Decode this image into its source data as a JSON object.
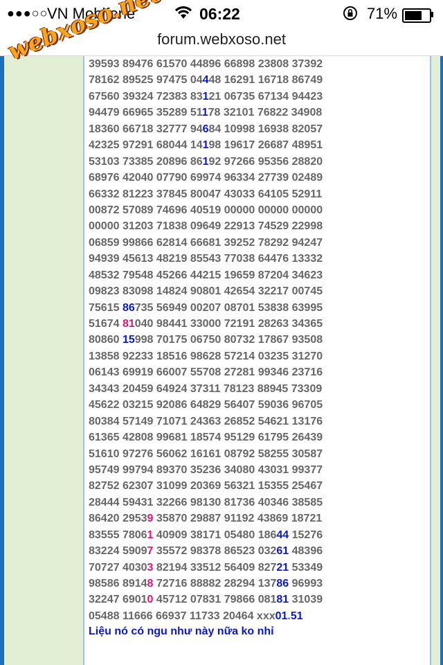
{
  "status_bar": {
    "signal": "●●●○○",
    "carrier": "VN Mobifone",
    "time": "06:22",
    "battery_percent": "71%",
    "battery_level": 0.71
  },
  "browser": {
    "url": "forum.webxoso.net"
  },
  "watermark": "webxoso.net",
  "colors": {
    "highlight_blue": "#0a18c8",
    "highlight_pink": "#e0157f",
    "numbers": "#666666",
    "sidebar": "#e2efd5",
    "border": "#1a6fbf"
  },
  "lines": [
    [
      {
        "t": "39593 89476 61570 44896 66898 23808 37392"
      }
    ],
    [
      {
        "t": "78162 89525 97475 04"
      },
      {
        "t": "4",
        "c": "blue"
      },
      {
        "t": "48 16291 16718 86749"
      }
    ],
    [
      {
        "t": "67560 39324 72383 83"
      },
      {
        "t": "1",
        "c": "blue"
      },
      {
        "t": "21 06735 67134 94423"
      }
    ],
    [
      {
        "t": "94479 66965 35289 51"
      },
      {
        "t": "1",
        "c": "blue"
      },
      {
        "t": "78 32101 76822 34908"
      }
    ],
    [
      {
        "t": "18360 66718 32777 94"
      },
      {
        "t": "6",
        "c": "blue"
      },
      {
        "t": "84 10998 16938 82057"
      }
    ],
    [
      {
        "t": "42325 97291 68044 14"
      },
      {
        "t": "1",
        "c": "blue"
      },
      {
        "t": "98 19617 26687 48951"
      }
    ],
    [
      {
        "t": "53103 73385 20896 86"
      },
      {
        "t": "1",
        "c": "blue"
      },
      {
        "t": "92 97266 95356 28820"
      }
    ],
    [
      {
        "t": "68976 42040 07790 69974 96334 27739 02489"
      }
    ],
    [
      {
        "t": "66332 81223 37845 80047 43033 64105 52911"
      }
    ],
    [
      {
        "t": "00872 57089 74696 40519 00000 00000 00000"
      }
    ],
    [
      {
        "t": "00000 31203 71838 09649 22913 74529 22998"
      }
    ],
    [
      {
        "t": "06859 99866 62814 66681 39252 78292 94247"
      }
    ],
    [
      {
        "t": "94939 45613 48219 85543 77038 64476 13332"
      }
    ],
    [
      {
        "t": "48532 79548 45266 44215 19659 87204 34623"
      }
    ],
    [
      {
        "t": "09823 83098 14824 90801 42654 32217 00745"
      }
    ],
    [
      {
        "t": "75615 "
      },
      {
        "t": "86",
        "c": "blue"
      },
      {
        "t": "735 56949 00207 08701 53838 63995"
      }
    ],
    [
      {
        "t": "51674 "
      },
      {
        "t": "81",
        "c": "pink"
      },
      {
        "t": "040 98441 33000 72191 28263 34365"
      }
    ],
    [
      {
        "t": "80860 "
      },
      {
        "t": "15",
        "c": "blue"
      },
      {
        "t": "998 70175 06750 80732 17867 93508"
      }
    ],
    [
      {
        "t": "13858 92233 18516 98628 57214 03235 31270"
      }
    ],
    [
      {
        "t": "06143 69919 66007 55708 27281 99346 23716"
      }
    ],
    [
      {
        "t": "34343 20459 64924 37311 78123 88945 73309"
      }
    ],
    [
      {
        "t": "45622 03215 92086 64829 56407 59036 96705"
      }
    ],
    [
      {
        "t": "80384 57149 71071 24363 26852 54621 13176"
      }
    ],
    [
      {
        "t": "61365 42808 99681 18574 95129 61795 26439"
      }
    ],
    [
      {
        "t": "51610 97276 56062 16161 08792 58255 30587"
      }
    ],
    [
      {
        "t": "95749 99794 89370 35236 34080 43031 99377"
      }
    ],
    [
      {
        "t": "82752 62307 31099 20369 56321 15355 25467"
      }
    ],
    [
      {
        "t": "28444 59431 32266 98130 81736 40346 38585"
      }
    ],
    [
      {
        "t": "86420 2953"
      },
      {
        "t": "9",
        "c": "pink"
      },
      {
        "t": " 35870 29887 91192 43869 18721"
      }
    ],
    [
      {
        "t": "83555 7806"
      },
      {
        "t": "1",
        "c": "pink"
      },
      {
        "t": " 40909 38171 05480 186"
      },
      {
        "t": "44",
        "c": "blue"
      },
      {
        "t": " 15276"
      }
    ],
    [
      {
        "t": "83224 5909"
      },
      {
        "t": "7",
        "c": "pink"
      },
      {
        "t": " 35572 98378 86523 032"
      },
      {
        "t": "61",
        "c": "blue"
      },
      {
        "t": " 48396"
      }
    ],
    [
      {
        "t": "70727 4030"
      },
      {
        "t": "3",
        "c": "pink"
      },
      {
        "t": " 82194 33512 56409 827"
      },
      {
        "t": "21",
        "c": "blue"
      },
      {
        "t": " 53349"
      }
    ],
    [
      {
        "t": "98586 8914"
      },
      {
        "t": "8",
        "c": "pink"
      },
      {
        "t": " 72716 88882 28294 137"
      },
      {
        "t": "86",
        "c": "blue"
      },
      {
        "t": " 96993"
      }
    ],
    [
      {
        "t": "32247 6901"
      },
      {
        "t": "0",
        "c": "pink"
      },
      {
        "t": " 45712 07831 79866 081"
      },
      {
        "t": "81",
        "c": "blue"
      },
      {
        "t": " 31039"
      }
    ],
    [
      {
        "t": "05488 11666 66937 11733 20464 xxx"
      },
      {
        "t": "01",
        "c": "blue"
      },
      {
        "t": "."
      },
      {
        "t": "51",
        "c": "blue"
      }
    ]
  ],
  "comment": "Liệu nó có ngu như này nữa ko nhỉ"
}
